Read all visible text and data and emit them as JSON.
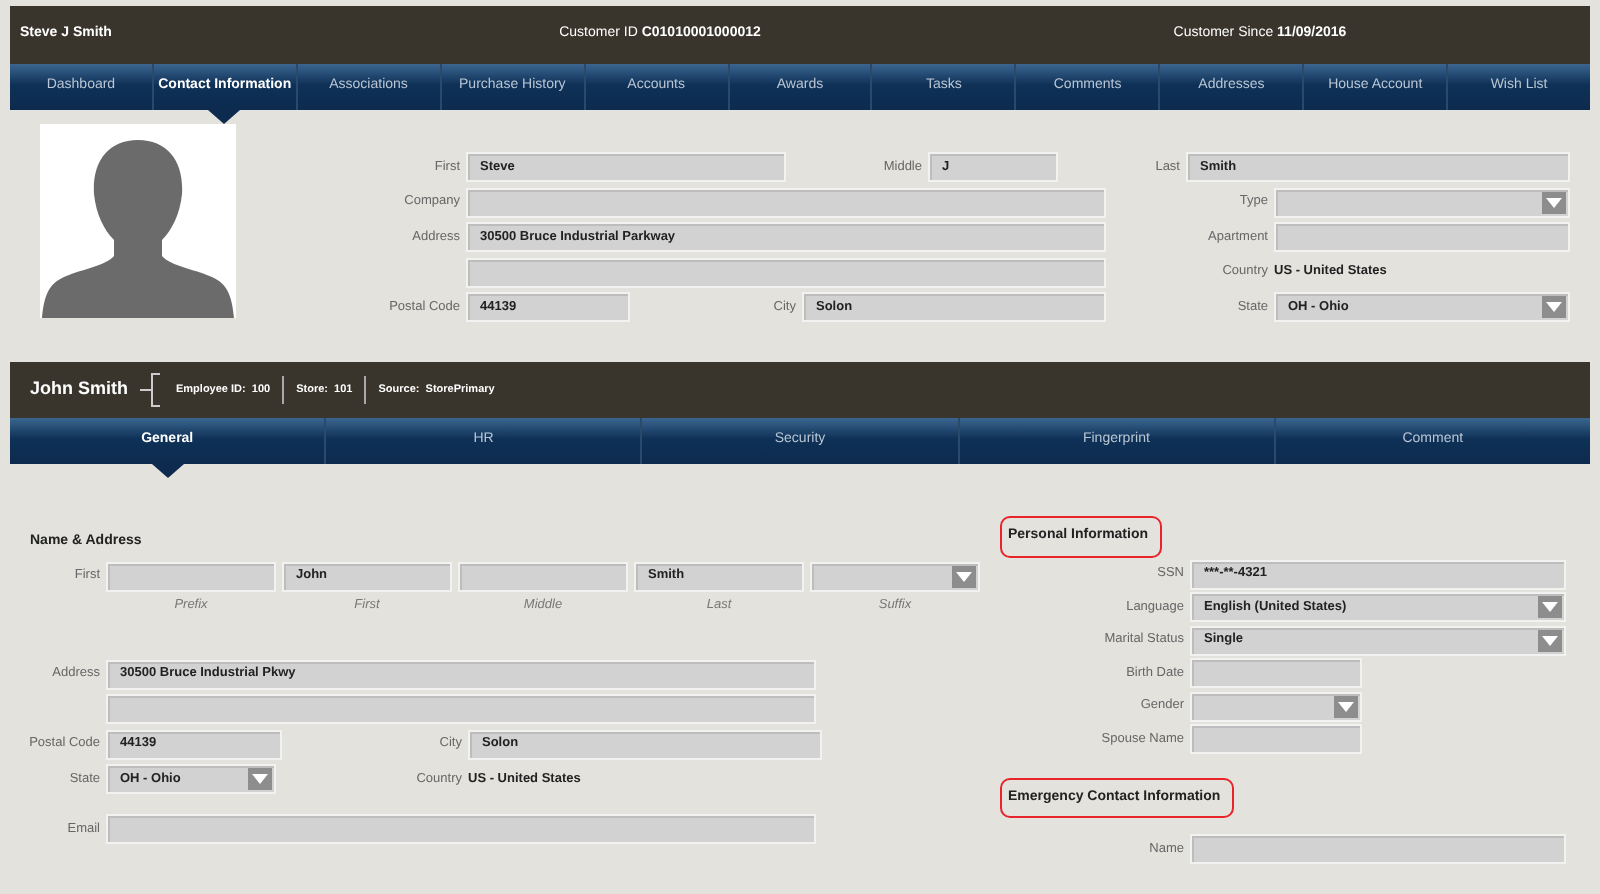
{
  "header": {
    "name": "Steve J Smith",
    "customer_id": {
      "label": "Customer ID",
      "value": "C01010001000012"
    },
    "customer_since": {
      "label": "Customer Since",
      "value": "11/09/2016"
    }
  },
  "nav_tabs": [
    {
      "label": "Dashboard",
      "selected": false
    },
    {
      "label": "Contact Information",
      "selected": true
    },
    {
      "label": "Associations",
      "selected": false
    },
    {
      "label": "Purchase History",
      "selected": false
    },
    {
      "label": "Accounts",
      "selected": false
    },
    {
      "label": "Awards",
      "selected": false
    },
    {
      "label": "Tasks",
      "selected": false
    },
    {
      "label": "Comments",
      "selected": false
    },
    {
      "label": "Addresses",
      "selected": false
    },
    {
      "label": "House Account",
      "selected": false
    },
    {
      "label": "Wish List",
      "selected": false
    }
  ],
  "contact": {
    "rows": [
      [
        {
          "label": "First",
          "value": "Steve",
          "kind": "text"
        },
        {
          "label": "Middle",
          "value": "J",
          "kind": "text"
        },
        {
          "label": "Last",
          "value": "Smith",
          "kind": "text"
        }
      ],
      [
        {
          "label": "Company",
          "kind": "text"
        },
        {
          "label": "Type",
          "kind": "select"
        }
      ],
      [
        {
          "label": "Address",
          "value": "30500 Bruce Industrial Parkway",
          "kind": "text"
        },
        {
          "label": "Apartment",
          "kind": "text"
        }
      ],
      [
        {
          "kind": "text"
        },
        {
          "label": "Country",
          "value": "US - United States",
          "kind": "static"
        }
      ],
      [
        {
          "label": "Postal Code",
          "value": "44139",
          "kind": "text"
        },
        {
          "label": "City",
          "value": "Solon",
          "kind": "text"
        },
        {
          "label": "State",
          "value": "OH - Ohio",
          "kind": "select"
        }
      ]
    ]
  },
  "employee": {
    "name": "John Smith",
    "meta": [
      {
        "label": "Employee ID:",
        "value": "100"
      },
      {
        "label": "Store:",
        "value": "101"
      },
      {
        "label": "Source:",
        "value": "StorePrimary"
      }
    ]
  },
  "sub_tabs": [
    {
      "label": "General",
      "selected": true
    },
    {
      "label": "HR",
      "selected": false
    },
    {
      "label": "Security",
      "selected": false
    },
    {
      "label": "Fingerprint",
      "selected": false
    },
    {
      "label": "Comment",
      "selected": false
    }
  ],
  "name_address": {
    "title": "Name & Address",
    "name_label": "First",
    "name_parts": [
      {
        "caption": "Prefix",
        "kind": "text"
      },
      {
        "caption": "First",
        "value": "John",
        "kind": "text"
      },
      {
        "caption": "Middle",
        "kind": "text"
      },
      {
        "caption": "Last",
        "value": "Smith",
        "kind": "text"
      },
      {
        "caption": "Suffix",
        "kind": "select"
      }
    ],
    "rows": [
      [
        {
          "label": "Address",
          "value": "30500 Bruce Industrial Pkwy",
          "kind": "text"
        }
      ],
      [
        {
          "kind": "text"
        }
      ],
      [
        {
          "label": "Postal Code",
          "value": "44139",
          "kind": "text"
        },
        {
          "label": "City",
          "value": "Solon",
          "kind": "text"
        }
      ],
      [
        {
          "label": "State",
          "value": "OH - Ohio",
          "kind": "select"
        },
        {
          "label": "Country",
          "value": "US - United States",
          "kind": "static"
        }
      ],
      [
        {
          "label": "Email",
          "kind": "text"
        }
      ]
    ]
  },
  "personal": {
    "title": "Personal Information",
    "highlighted": true,
    "fields": [
      {
        "label": "SSN",
        "value": "***-**-4321",
        "kind": "text"
      },
      {
        "label": "Language",
        "value": "English (United States)",
        "kind": "select"
      },
      {
        "label": "Marital Status",
        "value": "Single",
        "kind": "select"
      },
      {
        "label": "Birth Date",
        "kind": "text"
      },
      {
        "label": "Gender",
        "kind": "select"
      },
      {
        "label": "Spouse Name",
        "kind": "text"
      }
    ]
  },
  "emergency": {
    "title": "Emergency Contact Information",
    "highlighted": true,
    "fields": [
      {
        "label": "Name",
        "kind": "text"
      }
    ]
  }
}
